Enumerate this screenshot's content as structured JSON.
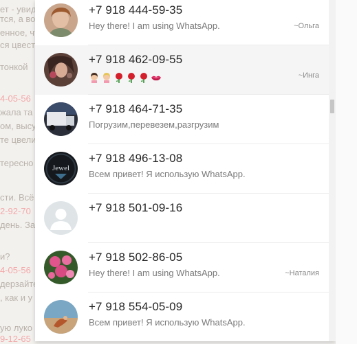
{
  "background_chat": {
    "fragments": [
      {
        "text": "ет - увид",
        "ts": false
      },
      {
        "text": "тся, а во",
        "ts": false
      },
      {
        "text": "енное, чт",
        "ts": false
      },
      {
        "text": "ся цвест",
        "ts": false
      },
      {
        "text": "тонкой",
        "ts": false
      },
      {
        "text": "4-05-56",
        "ts": true
      },
      {
        "text": "жала та",
        "ts": false
      },
      {
        "text": "ом, высу",
        "ts": false
      },
      {
        "text": "те цвели",
        "ts": false
      },
      {
        "text": "тересно",
        "ts": false
      },
      {
        "text": "сти. Всё",
        "ts": false
      },
      {
        "text": "2-92-70",
        "ts": true
      },
      {
        "text": "день. За",
        "ts": false
      },
      {
        "text": "и?",
        "ts": false
      },
      {
        "text": "4-05-56",
        "ts": true
      },
      {
        "text": "дерзайте",
        "ts": false
      },
      {
        "text": ", как и у",
        "ts": false
      },
      {
        "text": "ую луко",
        "ts": false
      },
      {
        "text": "9-12-65",
        "ts": true
      }
    ]
  },
  "contacts": [
    {
      "phone": "+7 918 444-59-35",
      "status": "Hey there! I am using WhatsApp.",
      "pushname": "~Ольга",
      "avatar": "photo-avatar-woman"
    },
    {
      "phone": "+7 918 462-09-55",
      "status": "",
      "pushname": "~Инга",
      "avatar": "photo-avatar-girl",
      "status_emojis": [
        "woman-emoji",
        "woman-emoji",
        "rose-emoji",
        "rose-emoji",
        "rose-emoji",
        "kiss-mark-emoji"
      ]
    },
    {
      "phone": "+7 918 464-71-35",
      "status": "Погрузим,перевезем,разгрузим",
      "pushname": "",
      "avatar": "photo-avatar-truck"
    },
    {
      "phone": "+7 918 496-13-08",
      "status": "Всем привет! Я использую WhatsApp.",
      "pushname": "",
      "avatar": "jewel-logo-avatar",
      "avatar_text": "Jewel"
    },
    {
      "phone": "+7 918 501-09-16",
      "status": "",
      "pushname": "",
      "avatar": "default-avatar"
    },
    {
      "phone": "+7 918 502-86-05",
      "status": "Hey there! I am using WhatsApp.",
      "pushname": "~Наталия",
      "avatar": "photo-avatar-flowers"
    },
    {
      "phone": "+7 918 554-05-09",
      "status": "Всем привет! Я использую WhatsApp.",
      "pushname": "",
      "avatar": "photo-avatar-beach"
    }
  ],
  "colors": {
    "panel_bg": "#ffffff",
    "selected_row": "#f5f5f5",
    "phone_text": "#262626",
    "status_text": "#7a7a7a",
    "timestamp_red": "#f2a9a9"
  }
}
